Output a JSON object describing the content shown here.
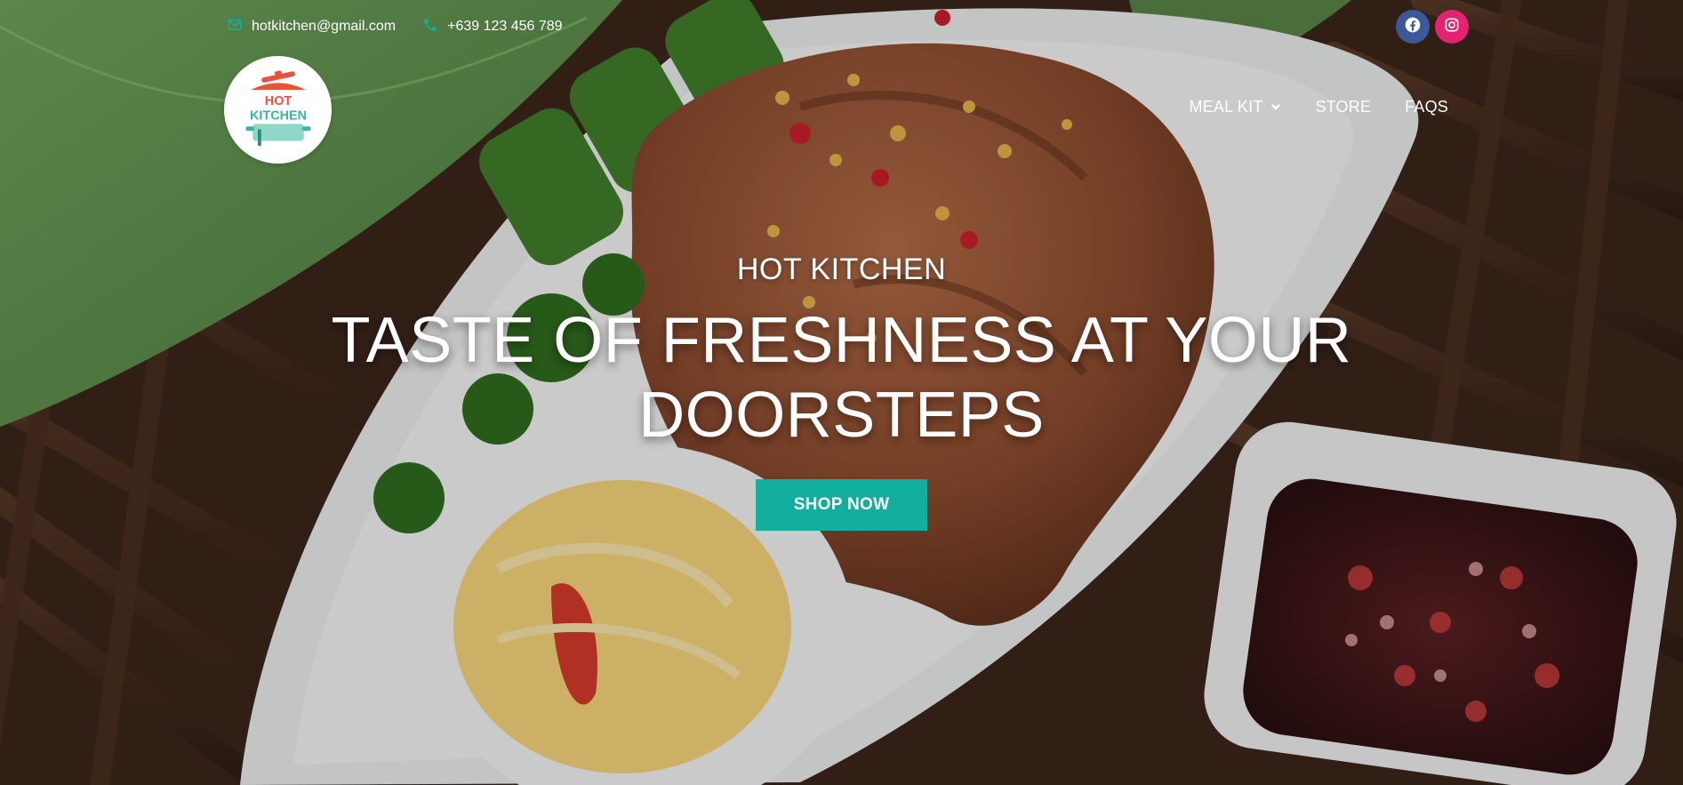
{
  "brand": {
    "name": "HOT KITCHEN",
    "logo_line1": "HOT",
    "logo_line2": "KITCHEN"
  },
  "topbar": {
    "email": "hotkitchen@gmail.com",
    "phone": "+639 123 456 789"
  },
  "social": {
    "facebook_icon": "facebook-icon",
    "instagram_icon": "instagram-icon"
  },
  "nav": {
    "items": [
      {
        "label": "MEAL KIT",
        "has_dropdown": true
      },
      {
        "label": "STORE"
      },
      {
        "label": "FAQS"
      }
    ]
  },
  "hero": {
    "kicker": "HOT KITCHEN",
    "headline": "TASTE OF FRESHNESS AT YOUR DOORSTEPS",
    "cta": "SHOP NOW"
  },
  "colors": {
    "accent": "#12ae9e",
    "facebook": "#3b5998",
    "instagram": "#e4226f",
    "logo_red": "#e8533b",
    "logo_teal": "#6cc8b5"
  }
}
